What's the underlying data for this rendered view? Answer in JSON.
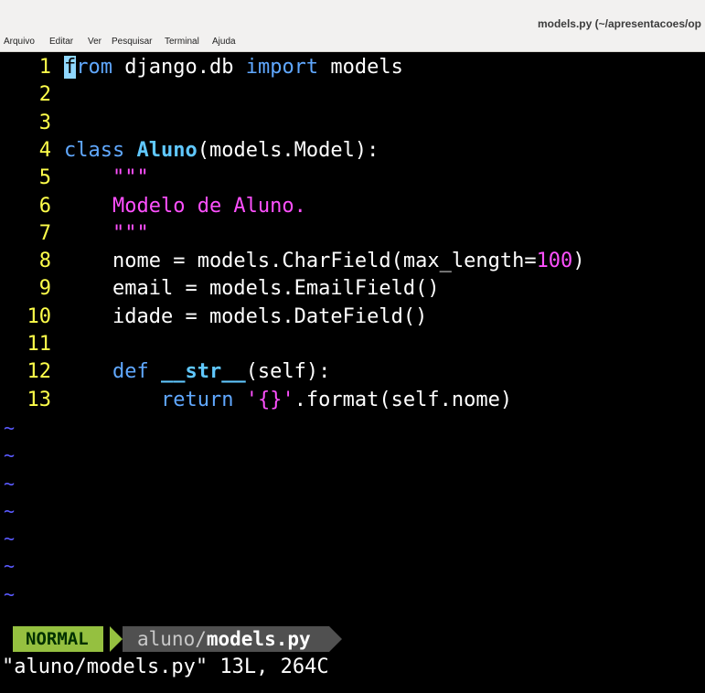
{
  "window": {
    "title": "models.py (~/apresentacoes/op"
  },
  "menu": [
    "Arquivo",
    "Editar",
    "Ver",
    "Pesquisar",
    "Terminal",
    "Ajuda"
  ],
  "editor": {
    "lines": [
      {
        "n": "1",
        "segments": [
          [
            "kw",
            "from"
          ],
          [
            "",
            " django.db "
          ],
          [
            "kw",
            "import"
          ],
          [
            "",
            " models"
          ]
        ],
        "cursor": true
      },
      {
        "n": "2",
        "segments": []
      },
      {
        "n": "3",
        "segments": []
      },
      {
        "n": "4",
        "segments": [
          [
            "kw",
            "class "
          ],
          [
            "cls",
            "Aluno"
          ],
          [
            "",
            "(models.Model):"
          ]
        ]
      },
      {
        "n": "5",
        "segments": [
          [
            "",
            "    "
          ],
          [
            "str",
            "\"\"\""
          ]
        ]
      },
      {
        "n": "6",
        "segments": [
          [
            "",
            "    "
          ],
          [
            "str",
            "Modelo de Aluno."
          ]
        ]
      },
      {
        "n": "7",
        "segments": [
          [
            "",
            "    "
          ],
          [
            "str",
            "\"\"\""
          ]
        ]
      },
      {
        "n": "8",
        "segments": [
          [
            "",
            "    nome = models.CharField(max_length="
          ],
          [
            "num",
            "100"
          ],
          [
            "",
            ")"
          ]
        ]
      },
      {
        "n": "9",
        "segments": [
          [
            "",
            "    email = models.EmailField()"
          ]
        ]
      },
      {
        "n": "10",
        "segments": [
          [
            "",
            "    idade = models.DateField()"
          ]
        ]
      },
      {
        "n": "11",
        "segments": []
      },
      {
        "n": "12",
        "segments": [
          [
            "",
            "    "
          ],
          [
            "kw",
            "def "
          ],
          [
            "fn",
            "__str__"
          ],
          [
            "",
            "(self):"
          ]
        ]
      },
      {
        "n": "13",
        "segments": [
          [
            "",
            "        "
          ],
          [
            "kw",
            "return"
          ],
          [
            "",
            " "
          ],
          [
            "str",
            "'{}'"
          ],
          [
            "",
            ".format(self.nome)"
          ]
        ]
      }
    ],
    "empty_line_marker": "~",
    "empty_line_count": 7
  },
  "statusline": {
    "mode": "NORMAL",
    "file_dir": "aluno/",
    "file_name": "models.py"
  },
  "command_line": "\"aluno/models.py\" 13L, 264C",
  "colors": {
    "keyword": "#60a8ff",
    "string": "#ff50ff",
    "line_number": "#ffff4a",
    "mode_bg": "#95c040"
  }
}
